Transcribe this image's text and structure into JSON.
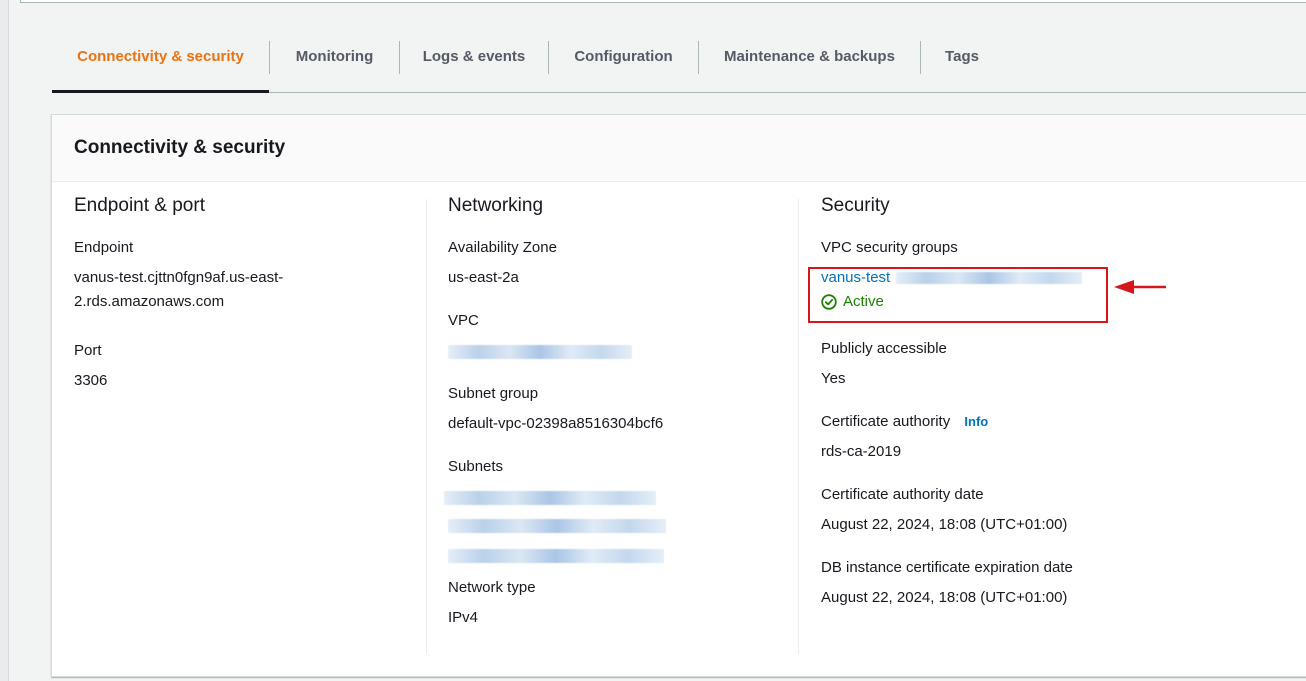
{
  "tabs": [
    {
      "label": "Connectivity & security",
      "active": true
    },
    {
      "label": "Monitoring",
      "active": false
    },
    {
      "label": "Logs & events",
      "active": false
    },
    {
      "label": "Configuration",
      "active": false
    },
    {
      "label": "Maintenance & backups",
      "active": false
    },
    {
      "label": "Tags",
      "active": false
    }
  ],
  "panel": {
    "title": "Connectivity & security",
    "endpoint_port": {
      "heading": "Endpoint & port",
      "endpoint_label": "Endpoint",
      "endpoint_line1": "vanus-test.cjttn0fgn9af.us-east-",
      "endpoint_line2": "2.rds.amazonaws.com",
      "port_label": "Port",
      "port_value": "3306"
    },
    "networking": {
      "heading": "Networking",
      "az_label": "Availability Zone",
      "az_value": "us-east-2a",
      "vpc_label": "VPC",
      "subnet_group_label": "Subnet group",
      "subnet_group_value": "default-vpc-02398a8516304bcf6",
      "subnets_label": "Subnets",
      "network_type_label": "Network type",
      "network_type_value": "IPv4"
    },
    "security": {
      "heading": "Security",
      "vpc_sg_label": "VPC security groups",
      "vpc_sg_value": "vanus-test",
      "vpc_sg_status": "Active",
      "public_label": "Publicly accessible",
      "public_value": "Yes",
      "ca_label": "Certificate authority",
      "ca_info": "Info",
      "ca_value": "rds-ca-2019",
      "ca_date_label": "Certificate authority date",
      "ca_date_value": "August 22, 2024, 18:08 (UTC+01:00)",
      "db_cert_label": "DB instance certificate expiration date",
      "db_cert_value": "August 22, 2024, 18:08 (UTC+01:00)"
    }
  },
  "colors": {
    "accent": "#ec7211",
    "link": "#0073bb",
    "success": "#1d8102",
    "annotation": "#d6161b"
  },
  "icons": {
    "status": "check-circle-icon",
    "annotation": "arrow-left-icon"
  }
}
